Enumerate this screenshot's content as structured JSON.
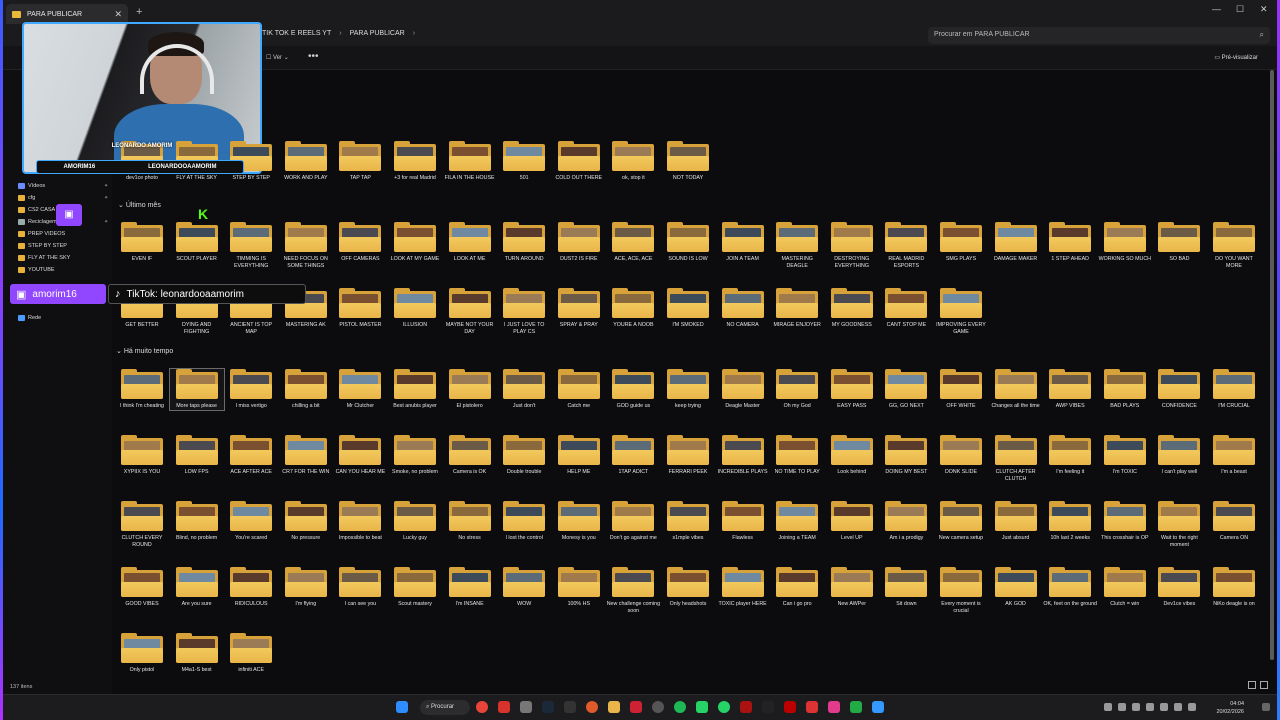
{
  "window": {
    "tab_title": "PARA PUBLICAR",
    "tab_close": "✕",
    "new_tab": "+",
    "controls": [
      "—",
      "☐",
      "✕"
    ]
  },
  "addressbar": {
    "crumbs": [
      "TIK TOK E REELS YT",
      "PARA PUBLICAR"
    ],
    "search_placeholder": "Procurar em PARA PUBLICAR"
  },
  "toolbar": {
    "view_label": "Ver",
    "more_label": "•••",
    "preview_label": "Pré-visualizar"
  },
  "sidebar": {
    "items": [
      {
        "label": "Vídeos"
      },
      {
        "label": "cfg"
      },
      {
        "label": "CS2 CASA NOVA"
      },
      {
        "label": "Reciclagem"
      },
      {
        "label": "PREP VIDEOS"
      },
      {
        "label": "STEP BY STEP"
      },
      {
        "label": "FLY AT THE SKY"
      },
      {
        "label": "YOUTUBE"
      },
      {
        "label": "Rede"
      }
    ]
  },
  "overlay": {
    "cam_name": "LEONARDO AMORIM",
    "cam_handles": [
      "AMORIM16",
      "LEONARDOOAAMORIM"
    ],
    "twitch_handle": "amorim16",
    "tiktok_handle": "TikTok: leonardooaamorim",
    "kick_letter": "K"
  },
  "groups": {
    "last_month": "Último mês",
    "long_ago": "Há muito tempo"
  },
  "folders_row1": [
    "dev1ce photo",
    "FLY AT THE SKY",
    "STEP BY STEP",
    "WORK AND PLAY",
    "TAP TAP",
    "+3 for real Madrid",
    "FILA IN THE HOUSE",
    "501",
    "COLD OUT THERE",
    "ok, stop it",
    "NOT TODAY"
  ],
  "folders_row2": [
    "EVEN IF",
    "SCOUT PLAYER",
    "TIMMING IS EVERYTHING",
    "NEED FOCUS ON SOME THINGS",
    "OFF CAMERAS",
    "LOOK AT MY GAME",
    "LOOK AT ME",
    "TURN AROUND",
    "DUST2 IS FIRE",
    "ACE, ACE, ACE",
    "SOUND IS LOW",
    "JOIN A TEAM",
    "MASTERING DEAGLE",
    "DESTROYING EVERYTHING",
    "REAL MADRID ESPORTS",
    "SMG PLAYS",
    "DAMAGE MAKER",
    "1 STEP AHEAD",
    "WORKING SO MUCH",
    "SO BAD",
    "DO YOU WANT MORE"
  ],
  "folders_row3": [
    "GET BETTER",
    "DYING AND FIGHTING",
    "ANCIENT IS TOP MAP",
    "MASTERING AK",
    "PISTOL MASTER",
    "ILLUSION",
    "MAYBE NOT YOUR DAY",
    "I JUST LOVE TO PLAY CS",
    "SPRAY & PRAY",
    "YOURE A NOOB",
    "I'M SMOKED",
    "NO CAMERA",
    "MIRAGE ENJOYER",
    "MY GOODNESS",
    "CANT STOP ME",
    "IMPROVING EVERY GAME"
  ],
  "folders_row4": [
    "I think I'm cheating",
    "More taps please",
    "I miss vertigo",
    "chilling a bit",
    "Mr Clutcher",
    "Best anubis player",
    "El pistolero",
    "Just don't",
    "Catch me",
    "GOD guide us",
    "keep trying",
    "Deagle Master",
    "Oh my God",
    "EASY PASS",
    "GG, GO NEXT",
    "OFF WHITE",
    "Changes all the time",
    "AWP VIBES",
    "BAD PLAYS",
    "CONFIDENCE",
    "I'M CRUCIAL"
  ],
  "folders_row5": [
    "XYPIIX IS YOU",
    "LOW FPS",
    "ACE AFTER ACE",
    "CR7 FOR THE WIN",
    "CAN YOU HEAR ME",
    "Smoke, no problem",
    "Camera is OK",
    "Double trouble",
    "HELP ME",
    "1TAP ADICT",
    "FERRARI PEEK",
    "INCREDIBLE PLAYS",
    "NO TIME TO PLAY",
    "Look behind",
    "DOING MY BEST",
    "DONK SLIDE",
    "CLUTCH AFTER CLUTCH",
    "I'm feeling it",
    "I'm TOXIC",
    "I can't play well",
    "I'm a beast"
  ],
  "folders_row6": [
    "CLUTCH EVERY ROUND",
    "Blind, no problem",
    "You're scared",
    "No pressure",
    "Impossible to beat",
    "Lucky guy",
    "No stress",
    "I lost the control",
    "Monesy is you",
    "Don't go against me",
    "s1mple vibes",
    "Flawless",
    "Joining a TEAM",
    "Level UP",
    "Am i a prodigy",
    "New camera setup",
    "Just absurd",
    "10h last 2 weeks",
    "This crosshair is OP",
    "Wait to the right moment",
    "Camera ON"
  ],
  "folders_row7": [
    "GOOD VIBES",
    "Are you sure",
    "RIDICULOUS",
    "I'm flying",
    "I can see you",
    "Scout mastery",
    "I'm INSANE",
    "WOW",
    "100% HS",
    "New challenge coming soon",
    "Only headshots",
    "TOXIC player HERE",
    "Can i go pro",
    "New AWPer",
    "Sit down",
    "Every moment is crucial",
    "AK GOD",
    "OK, feet on the ground",
    "Clutch = win",
    "Dev1ce vibes",
    "NiKo deagle is on"
  ],
  "folders_row8": [
    "Only pistol",
    "M4a1-S best",
    "infiniti ACE"
  ],
  "status": {
    "item_count": "137 itens"
  },
  "taskbar": {
    "search_label": "Procurar",
    "time": "04:04",
    "date": "20/02/2026"
  },
  "colors": {
    "accent_blue": "#3fa8ff",
    "twitch": "#9147ff",
    "folder": "#e9b54a"
  }
}
